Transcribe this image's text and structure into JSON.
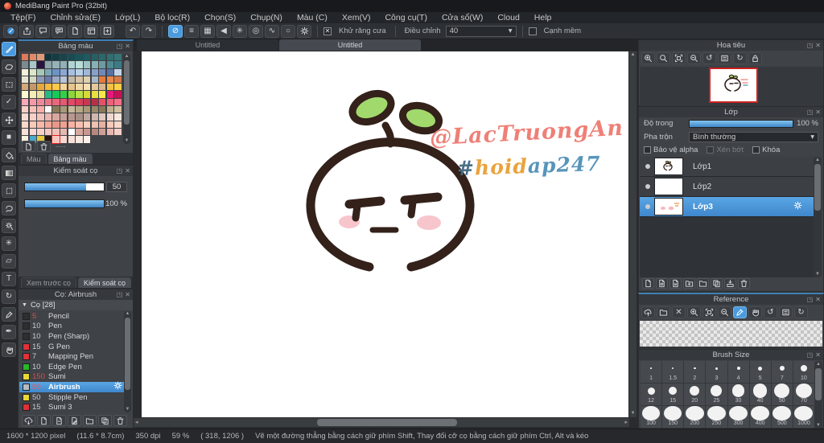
{
  "window": {
    "title": "MediBang Paint Pro (32bit)"
  },
  "menu": {
    "items": [
      "Tệp(F)",
      "Chỉnh sửa(E)",
      "Lớp(L)",
      "Bộ lọc(R)",
      "Chọn(S)",
      "Chụp(N)",
      "Màu (C)",
      "Xem(V)",
      "Công cụ(T)",
      "Cửa sổ(W)",
      "Cloud",
      "Help"
    ]
  },
  "toolbar": {
    "file_icons": [
      "cloud-paint",
      "export",
      "bubble",
      "comment",
      "document",
      "panel",
      "new-canvas"
    ],
    "history_icons": [
      "undo",
      "redo"
    ],
    "snap_icons": [
      "snap-off",
      "snap-parallel",
      "snap-grid",
      "snap-vanishing",
      "snap-radial",
      "snap-concentric",
      "snap-curve",
      "snap-ellipse",
      "snap-settings"
    ],
    "active_snap": "snap-off",
    "antialias_label": "Khử răng cưa",
    "antialias_checked": true,
    "adjust_label": "Điều chỉnh",
    "adjust_value": "40",
    "soft_edge_label": "Cạnh mềm",
    "soft_edge_checked": false
  },
  "tools": {
    "items": [
      "brush",
      "eraser",
      "marquee",
      "select-pen",
      "move",
      "shape-brush",
      "bucket",
      "gradient",
      "select",
      "lasso",
      "magic-wand",
      "filter",
      "stamp",
      "text",
      "select-move",
      "eyedropper",
      "divide",
      "hand"
    ],
    "active": "brush"
  },
  "palette_panel": {
    "title": "Bảng màu",
    "buttons": [
      "add-color",
      "delete-color"
    ],
    "swatch_label": "----",
    "tabs": [
      "Màu",
      "Bảng màu"
    ],
    "active_tab": "Bảng màu",
    "selected": {
      "row": 11,
      "col": 4
    },
    "colors": [
      [
        "#dd7a5c",
        "#df8a68",
        "#e09a78",
        "#12343c",
        "#143c44",
        "#16444c",
        "#184c53",
        "#1b535a",
        "#1f5a60",
        "#246166",
        "#29686c",
        "#2f6f72",
        "#367678"
      ],
      [
        "#7b8c91",
        "#a9c5c9",
        "#2a1343",
        "#8ba5aa",
        "#94b3b7",
        "#90b1b5",
        "#afd4d4",
        "#b9ddd8",
        "#9dc4c4",
        "#87b1b5",
        "#6c9ba1",
        "#4c8b93",
        "#3c7b86"
      ],
      [
        "#f4efd8",
        "#dae8c8",
        "#a6c9b4",
        "#7ba8b8",
        "#6b93c4",
        "#8ba8d4",
        "#a8c0e0",
        "#b8d0e8",
        "#a0b8d8",
        "#88a0c8",
        "#7188b8",
        "#5871a8",
        "#c4d4e8"
      ],
      [
        "#e8e4d3",
        "#d4d8c3",
        "#8b9ab8",
        "#6b7aa8",
        "#9aa8c4",
        "#b8c4d8",
        "#c4b8a8",
        "#d4c4a8",
        "#e0d0b0",
        "#a8b8c8",
        "#e87a3a",
        "#e88a4a",
        "#d87a45"
      ],
      [
        "#d4a878",
        "#c49868",
        "#e8a838",
        "#f5b842",
        "#ffc84a",
        "#f5d498",
        "#e8c488",
        "#f0d8a8",
        "#f8e0b0",
        "#e8c898",
        "#d8b888",
        "#f5c045",
        "#ffd045"
      ],
      [
        "#fdfacf",
        "#f5edb7",
        "#e8e09f",
        "#28b888",
        "#18c858",
        "#30d048",
        "#88d838",
        "#b8e048",
        "#d8d838",
        "#e8e040",
        "#f5e848",
        "#e81878",
        "#c81058"
      ],
      [
        "#f8a8b8",
        "#f598a8",
        "#f08898",
        "#e87888",
        "#e8687a",
        "#e85870",
        "#e84868",
        "#d84058",
        "#c83850",
        "#b83048",
        "#e8506a",
        "#f06078",
        "#f87088"
      ],
      [
        "#f8d0c8",
        "#f8c0b8",
        "#f8b0a8",
        "#ffffff",
        "#8a7a5a",
        "#a89878",
        "#c8b898",
        "#b8a888",
        "#a89878",
        "#988868",
        "#887858",
        "#c0b090",
        "#d0c0a0"
      ],
      [
        "#f8ddd3",
        "#f8cfc7",
        "#f0c3bb",
        "#e8b7af",
        "#d8a79f",
        "#c89f97",
        "#b8978f",
        "#a88f87",
        "#c0a79f",
        "#d0b7af",
        "#e0c7bf",
        "#f0d7cf",
        "#f8e7df"
      ],
      [
        "#f8d8c8",
        "#f8c8b8",
        "#f8b8a8",
        "#f0a898",
        "#e89888",
        "#f0a090",
        "#f8b0a0",
        "#f8c0b0",
        "#f8d0c0",
        "#f0c0b0",
        "#e8b0a0",
        "#f8c8b8",
        "#f8d8c8"
      ],
      [
        "#f8e0d8",
        "#f8d8d0",
        "#f8d0c8",
        "#f8c8c0",
        "#f0c0b8",
        "#e8b8b0",
        "#ffffff",
        "#d8a8a0",
        "#c89890",
        "#b88880",
        "#d0a098",
        "#e8b8b0",
        "#f8d0c8"
      ],
      [
        "#f8f0e0",
        "#4aa8c8",
        "#e8c838",
        "#2a1410",
        "#f8c8c0",
        "#f8d8d0",
        "#f8e0d8",
        "#f8e8e0",
        "#fdf2ea",
        null,
        null,
        null,
        null
      ]
    ]
  },
  "brush_control_panel": {
    "title": "Kiểm soát cọ",
    "size_value": "50",
    "size_fill_pct": 78,
    "opacity_value": "100 %",
    "opacity_fill_pct": 100,
    "tabs": [
      "Xem trước cọ",
      "Kiểm soát cọ"
    ],
    "active_tab": "Kiểm soát cọ"
  },
  "brush_panel": {
    "title": "Cọ: Airbrush",
    "group_label": "Cọ [28]",
    "buttons": [
      "cloud-brush",
      "add-brush",
      "add-brush-menu",
      "edit-brush",
      "brush-folder",
      "duplicate-brush",
      "delete-brush"
    ],
    "brushes": [
      {
        "size": "5",
        "name": "Pencil",
        "swatch": "#2e2e2e",
        "size_color": "#d05050",
        "selected": false
      },
      {
        "size": "10",
        "name": "Pen",
        "swatch": "#2e2e2e",
        "size_color": "#c8cbd0",
        "selected": false
      },
      {
        "size": "10",
        "name": "Pen (Sharp)",
        "swatch": "#2e2e2e",
        "size_color": "#c8cbd0",
        "selected": false
      },
      {
        "size": "15",
        "name": "G Pen",
        "swatch": "#e03038",
        "size_color": "#c8cbd0",
        "selected": false
      },
      {
        "size": "7",
        "name": "Mapping Pen",
        "swatch": "#e03038",
        "size_color": "#c8cbd0",
        "selected": false
      },
      {
        "size": "10",
        "name": "Edge Pen",
        "swatch": "#28b828",
        "size_color": "#c8cbd0",
        "selected": false
      },
      {
        "size": "150",
        "name": "Sumi",
        "swatch": "#e8d830",
        "size_color": "#d05050",
        "selected": false
      },
      {
        "size": "50",
        "name": "Airbrush",
        "swatch": "#b8bcc0",
        "size_color": "#e06060",
        "selected": true
      },
      {
        "size": "50",
        "name": "Stipple Pen",
        "swatch": "#e8d830",
        "size_color": "#c8cbd0",
        "selected": false
      },
      {
        "size": "15",
        "name": "Sumi 3",
        "swatch": "#e03038",
        "size_color": "#c8cbd0",
        "selected": false
      }
    ]
  },
  "doc_tabs": {
    "items": [
      "Untitled",
      "Untitled"
    ],
    "active_index": 1
  },
  "canvas_art": {
    "handle_text": "@LacTruongAn",
    "handle_color": "#ee8077",
    "hashtag_hash": "#",
    "hashtag_hash_color": "#486f85",
    "hashtag_part1": "hoid",
    "hashtag_part1_color": "#eaa33d",
    "hashtag_part2": "ap247",
    "hashtag_part2_color": "#5795bb",
    "outline_color": "#33211a",
    "leaf_color": "#a2d96d",
    "blush_color": "#f6c0c6"
  },
  "navigator_panel": {
    "title": "Hoa tiêu",
    "toolbar": [
      "zoom-in",
      "zoom-actual",
      "fit-window",
      "zoom-out",
      "rotate-ccw",
      "reset-view",
      "rotate-cw",
      "lock"
    ]
  },
  "layer_panel": {
    "title": "Lớp",
    "opacity_label": "Độ trong",
    "opacity_value": "100 %",
    "blend_label": "Pha trộn",
    "blend_value": "Bình thường",
    "checkbox_alpha": "Bảo vệ alpha",
    "checkbox_clip": "Xén bớt",
    "checkbox_lock": "Khóa",
    "layers": [
      {
        "name": "Lớp1",
        "thumb": "art",
        "selected": false
      },
      {
        "name": "Lớp2",
        "thumb": "empty",
        "selected": false
      },
      {
        "name": "Lớp3",
        "thumb": "smudge",
        "selected": true
      }
    ],
    "buttons": [
      "add-layer",
      "add-pixel-layer",
      "add-8bit-layer",
      "add-folder",
      "folder",
      "duplicate",
      "merge-down",
      "delete"
    ]
  },
  "reference_panel": {
    "title": "Reference",
    "toolbar": [
      "upload",
      "folder",
      "clear",
      "zoom-in",
      "fit-window",
      "zoom-out",
      "eyedropper",
      "hand",
      "rotate-ccw",
      "reset-view",
      "rotate-cw"
    ],
    "active_tool": "eyedropper"
  },
  "brush_size_panel": {
    "title": "Brush Size",
    "sizes": [
      "1",
      "1.5",
      "2",
      "3",
      "4",
      "5",
      "7",
      "10",
      "12",
      "15",
      "20",
      "25",
      "30",
      "40",
      "50",
      "70",
      "100",
      "150",
      "200",
      "250",
      "300",
      "400",
      "500",
      "1000"
    ],
    "diameters": [
      1.5,
      2,
      2.5,
      3,
      4,
      5,
      6,
      8,
      9,
      10.5,
      12,
      14,
      15.5,
      17.5,
      19,
      20.5,
      21.5,
      22,
      22.5,
      22.5,
      23,
      23,
      23,
      23
    ]
  },
  "status_bar": {
    "segments": [
      "1600 * 1200 pixel",
      "(11.6 * 8.7cm)",
      "350 dpi",
      "59 %",
      "( 318, 1206 )",
      "Vẽ một đường thẳng bằng cách giữ phím Shift, Thay đổi cỡ cọ bằng cách giữ phím Ctrl, Alt và kéo"
    ]
  }
}
